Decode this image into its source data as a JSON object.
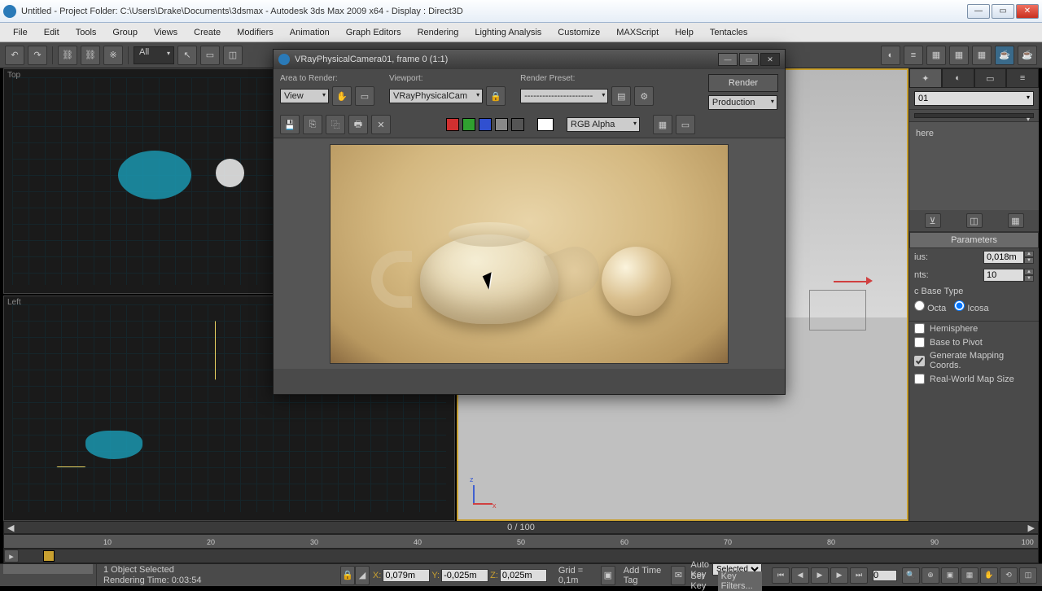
{
  "window": {
    "title": "Untitled    - Project Folder: C:\\Users\\Drake\\Documents\\3dsmax    - Autodesk 3ds Max  2009 x64      - Display : Direct3D"
  },
  "menu": [
    "File",
    "Edit",
    "Tools",
    "Group",
    "Views",
    "Create",
    "Modifiers",
    "Animation",
    "Graph Editors",
    "Rendering",
    "Lighting Analysis",
    "Customize",
    "MAXScript",
    "Help",
    "Tentacles"
  ],
  "toolbar": {
    "selection_set": "All"
  },
  "viewports": {
    "top": "Top",
    "left": "Left",
    "persp": "VRayPhysicalCamera01"
  },
  "render_window": {
    "title": "VRayPhysicalCamera01, frame 0 (1:1)",
    "area_label": "Area to Render:",
    "area_value": "View",
    "viewport_label": "Viewport:",
    "viewport_value": "VRayPhysicalCam",
    "preset_label": "Render Preset:",
    "preset_value": "-----------------------",
    "production_value": "Production",
    "render_btn": "Render",
    "channel_combo": "RGB Alpha"
  },
  "command_panel": {
    "object_type": "here",
    "rollout_params": "Parameters",
    "radius_label": "ius:",
    "radius_value": "0,018m",
    "segments_label": "nts:",
    "segments_value": "10",
    "basetype_label": "c Base Type",
    "radio_octa": "Octa",
    "radio_icosa": "Icosa",
    "chk_hemisphere": "Hemisphere",
    "chk_basepivot": "Base to Pivot",
    "chk_mapping": "Generate Mapping Coords.",
    "chk_realworld": "Real-World Map Size"
  },
  "timeline": {
    "frame": "0 / 100",
    "ticks": [
      "10",
      "20",
      "30",
      "40",
      "50",
      "60",
      "70",
      "80",
      "90",
      "100"
    ]
  },
  "status": {
    "selection": "1 Object Selected",
    "render_time": "Rendering Time: 0:03:54",
    "x_label": "X:",
    "x_val": "0,079m",
    "y_label": "Y:",
    "y_val": "-0,025m",
    "z_label": "Z:",
    "z_val": "0,025m",
    "grid": "Grid = 0,1m",
    "add_tag": "Add Time Tag",
    "auto_key": "Auto Key",
    "set_key": "Set Key",
    "selected": "Selected",
    "key_filters": "Key Filters...",
    "frame_field": "0"
  }
}
